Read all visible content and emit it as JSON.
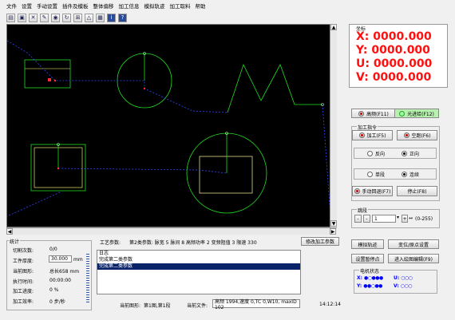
{
  "menu": [
    "文件",
    "设置",
    "手动设置",
    "插件及模板",
    "整体偏移",
    "加工信息",
    "模拟轨迹",
    "加工取料",
    "帮助"
  ],
  "toolbar_icons": [
    "open-icon",
    "save-icon",
    "tool-icon",
    "edit-icon",
    "zoom-icon",
    "rotate-icon",
    "grid-icon",
    "layer-icon",
    "view-icon",
    "info-icon",
    "help-icon"
  ],
  "coords": {
    "title": "坐标",
    "x_label": "X:",
    "x_value": "0000.000",
    "y_label": "Y:",
    "y_value": "0000.000",
    "u_label": "U:",
    "u_value": "0000.000",
    "v_label": "V:",
    "v_value": "0000.000"
  },
  "controls": {
    "hf_label": "高频(F11)",
    "follow_label": "光进给(F12)",
    "process_group": "加工指令",
    "process_label": "加工(F5)",
    "dry_run_label": "空跑(F6)",
    "reverse_label": "反向",
    "forward_label": "正向",
    "single_label": "单段",
    "continuous_label": "连续",
    "manual_label": "手动回退(F7)",
    "stop_label": "停止(F8)",
    "jump_group": "跳段",
    "jump_value": "1",
    "jump_range": "(0-255)",
    "simulate_label": "模拟轨迹",
    "origin_label": "变位/原点设置",
    "set_point_label": "设置暂停点",
    "graph_edit_label": "进入绘图编辑(F9)",
    "motor_group": "电机状态",
    "motor_x": "X:",
    "motor_y": "Y:",
    "motor_u": "U:",
    "motor_v": "V:"
  },
  "stats": {
    "title": "统计",
    "cut_count_label": "切割次数:",
    "cut_count": "0/0",
    "thickness_label": "工件厚度:",
    "thickness": "30.000",
    "thickness_unit": "mm",
    "graph_label": "当前图形:",
    "graph": "总长658 mm",
    "exec_time_label": "执行时间:",
    "exec_time": "00:00:00",
    "progress_label": "加工进度:",
    "progress": "0 %",
    "speed_label": "加工效率:",
    "speed": "0 步/秒"
  },
  "params": {
    "label": "工艺参数:",
    "value": "第2类参数: 脉宽 5 脉间 8 高频功率 2 变频阻值 3 限速 330",
    "edit_button": "修改加工参数"
  },
  "log": {
    "title": "日志",
    "rows": [
      "完成第二类参数",
      "完成第二类参数"
    ]
  },
  "footer": {
    "current_graph_label": "当前图形:",
    "current_graph": "第1图,第1段",
    "current_file_label": "当前文件:",
    "current_file": "高频 1994,速度 0,TC 0,W10, maxID 102",
    "time": "14:12:14"
  }
}
